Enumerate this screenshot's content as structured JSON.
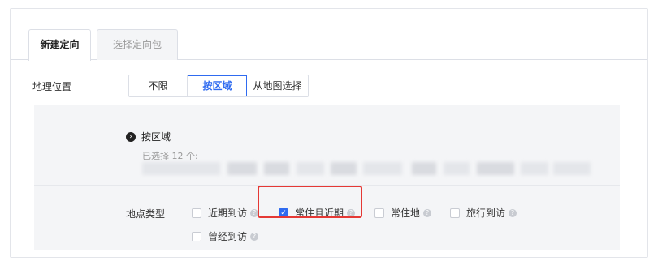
{
  "tabs": [
    {
      "label": "新建定向",
      "active": true
    },
    {
      "label": "选择定向包",
      "active": false
    }
  ],
  "geo": {
    "label": "地理位置",
    "options": [
      "不限",
      "按区域",
      "从地图选择"
    ],
    "selected": "按区域"
  },
  "area": {
    "title": "按区域",
    "selected_count": "已选择 12 个:"
  },
  "location_type": {
    "label": "地点类型",
    "options": [
      {
        "label": "近期到访",
        "checked": false
      },
      {
        "label": "常住且近期",
        "checked": true
      },
      {
        "label": "常住地",
        "checked": false
      },
      {
        "label": "旅行到访",
        "checked": false
      },
      {
        "label": "曾经到访",
        "checked": false
      }
    ]
  },
  "colors": {
    "accent": "#2f6bf0",
    "highlight": "#e53935"
  },
  "icons": {
    "area_bullet": "chevron-right-circle-icon",
    "help": "question-mark-circle-icon",
    "check": "checkmark-icon"
  }
}
